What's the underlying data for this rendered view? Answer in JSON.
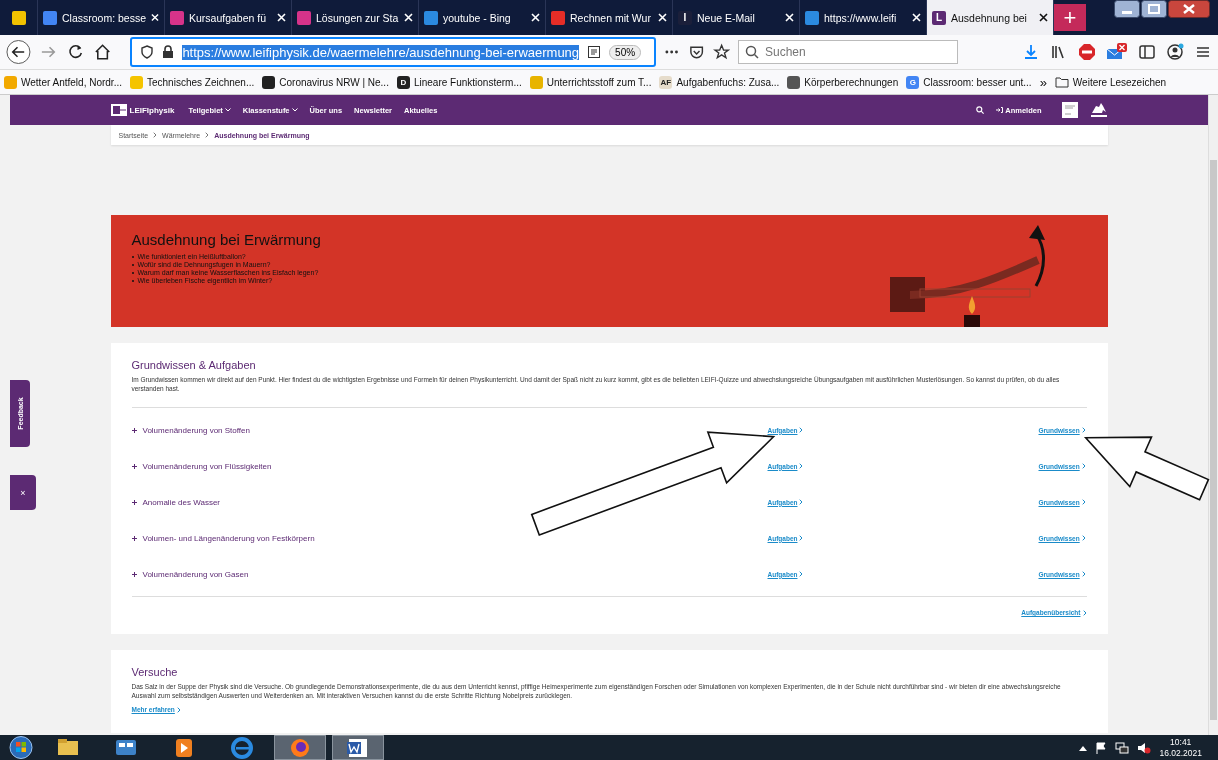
{
  "browser": {
    "tabs": [
      {
        "selected": false,
        "color": "#f2c200"
      },
      {
        "label": "Classroom: besse",
        "selected": false,
        "color": "#4285f4"
      },
      {
        "label": "Kursaufgaben fü",
        "selected": false,
        "color": "#d6338a"
      },
      {
        "label": "Lösungen zur Sta",
        "selected": false,
        "color": "#d6338a"
      },
      {
        "label": "youtube - Bing",
        "selected": false,
        "color": "#2b8ae0"
      },
      {
        "label": "Rechnen mit Wur",
        "selected": false,
        "color": "#e52d27"
      },
      {
        "label": "Neue E-Mail",
        "selected": false,
        "color": "#1b1f3a",
        "glyph": "I"
      },
      {
        "label": "https://www.leifi",
        "selected": false,
        "color": "#2b8ae0"
      },
      {
        "label": "Ausdehnung bei",
        "selected": true,
        "color": "#5c2a73",
        "glyph": "L"
      }
    ],
    "new_tab": "+",
    "url": "https://www.leifiphysik.de/waermelehre/ausdehnung-bei-erwaermung",
    "zoom": "50%",
    "search": {
      "placeholder": "Suchen"
    },
    "bookmarks": [
      {
        "label": "Wetter Antfeld, Nordr...",
        "color": "#f2a900"
      },
      {
        "label": "Technisches Zeichnen...",
        "color": "#f5c400"
      },
      {
        "label": "Coronavirus NRW | Ne...",
        "color": "#222222"
      },
      {
        "label": "Lineare Funktionsterm...",
        "color": "#222222",
        "glyph": "D"
      },
      {
        "label": "Unterrichtsstoff zum T...",
        "color": "#e8b400"
      },
      {
        "label": "Aufgabenfuchs: Zusa...",
        "color": "#e6dccb",
        "glyph": "AF"
      },
      {
        "label": "Körperberechnungen",
        "color": "#555555"
      },
      {
        "label": "Classroom: besser unt...",
        "color": "#4285f4",
        "glyph": "G"
      }
    ],
    "more_bookmarks": "»",
    "other_bookmarks": "Weitere Lesezeichen"
  },
  "site": {
    "logo": "LEIFIphysik",
    "menu": [
      {
        "label": "Teilgebiet",
        "dropdown": true
      },
      {
        "label": "Klassenstufe",
        "dropdown": true
      },
      {
        "label": "Über uns",
        "dropdown": false
      },
      {
        "label": "Newsletter",
        "dropdown": false
      },
      {
        "label": "Aktuelles",
        "dropdown": false
      }
    ],
    "login": "Anmelden",
    "breadcrumb": [
      "Startseite",
      "Wärmelehre",
      "Ausdehnung bei Erwärmung"
    ],
    "hero": {
      "title": "Ausdehnung bei Erwärmung",
      "questions": [
        "Wie funktioniert ein Heißluftballon?",
        "Wofür sind die Dehnungsfugen in Mauern?",
        "Warum darf man keine Wasserflaschen ins Eisfach legen?",
        "Wie überleben Fische eigentlich im Winter?"
      ]
    },
    "basics": {
      "title": "Grundwissen & Aufgaben",
      "intro": "Im Grundwissen kommen wir direkt auf den Punkt. Hier findest du die wichtigsten Ergebnisse und Formeln für deinen Physikunterricht. Und damit der Spaß nicht zu kurz kommt, gibt es die beliebten LEIFI-Quizze und abwechslungsreiche Übungsaufgaben mit ausführlichen Musterlösungen. So kannst du prüfen, ob du alles verstanden hast.",
      "topics": [
        {
          "label": "Volumenänderung von Stoffen",
          "links": [
            {
              "label": "Aufgaben",
              "arrow": true
            },
            {
              "label": "Grundwissen",
              "arrow": true
            }
          ]
        },
        {
          "label": "Volumenänderung von Flüssigkeiten",
          "links": [
            {
              "label": "Aufgaben",
              "arrow": false
            },
            {
              "label": "Grundwissen",
              "arrow": false
            }
          ]
        },
        {
          "label": "Anomalie des Wasser",
          "links": [
            {
              "label": "Aufgaben",
              "arrow": false
            },
            {
              "label": "Grundwissen",
              "arrow": false
            }
          ]
        },
        {
          "label": "Volumen- und Längenänderung von Festkörpern",
          "links": [
            {
              "label": "Aufgaben",
              "arrow": false
            },
            {
              "label": "Grundwissen",
              "arrow": false
            }
          ]
        },
        {
          "label": "Volumenänderung von Gasen",
          "links": [
            {
              "label": "Aufgaben",
              "arrow": false
            },
            {
              "label": "Grundwissen",
              "arrow": false
            }
          ]
        }
      ],
      "overview": "Aufgabenübersicht"
    },
    "experiments": {
      "title": "Versuche",
      "text": "Das Salz in der Suppe der Physik sind die Versuche. Ob grundlegende Demonstrationsexperimente, die du aus dem Unterricht kennst, pfiffige Heimexperimente zum eigenständigen Forschen oder Simulationen von komplexen Experimenten, die in der Schule nicht durchführbar sind - wir bieten dir eine abwechslungsreiche Auswahl zum selbstständigen Auswerten und Weiterdenken an. Mit interaktiven Versuchen kannst du die erste Schritte Richtung Nobelpreis zurücklegen.",
      "more": "Mehr erfahren"
    },
    "feedback": "Feedback",
    "feedback_close": "×"
  },
  "taskbar": {
    "apps": [
      {
        "kind": "explorer",
        "active": false
      },
      {
        "kind": "media-center",
        "active": false
      },
      {
        "kind": "media-player",
        "active": false
      },
      {
        "kind": "ie",
        "active": false
      },
      {
        "kind": "firefox",
        "active": true
      },
      {
        "kind": "word",
        "active": true
      }
    ],
    "time": "10:41",
    "date": "16.02.2021"
  }
}
